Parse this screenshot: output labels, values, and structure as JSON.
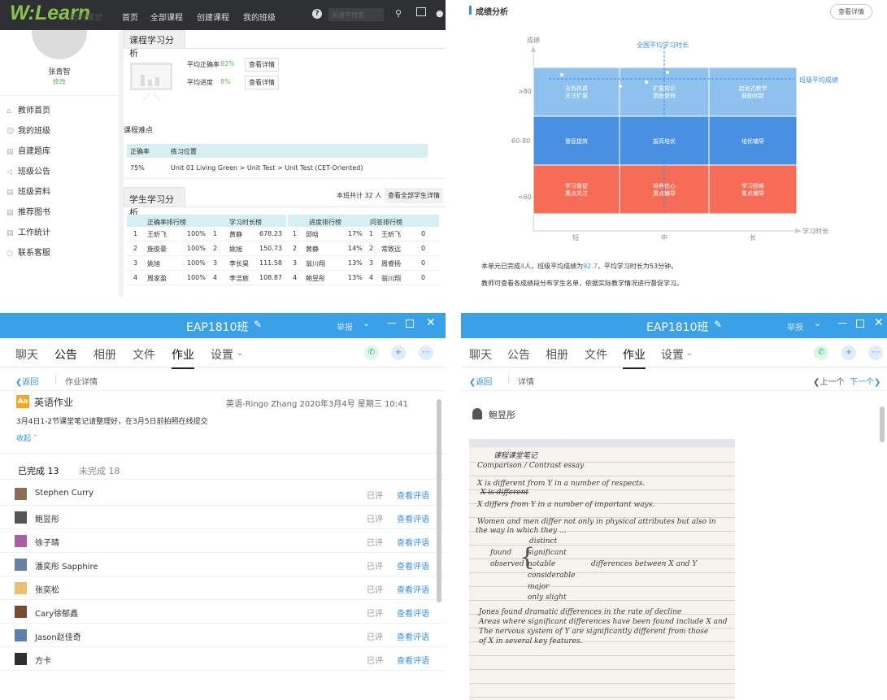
{
  "q1": {
    "logo": "W:Learn",
    "logo_sub": "随行课堂",
    "nav": [
      "首页",
      "全部课程",
      "创建课程",
      "我的班级"
    ],
    "search_placeholder": "关键字搜索",
    "user_name": "张青智",
    "user_edit": "修改",
    "side_items": [
      {
        "label": "教师首页",
        "icon": "home-icon"
      },
      {
        "label": "我的班级",
        "icon": "users-icon"
      },
      {
        "label": "自建题库",
        "icon": "book-icon"
      },
      {
        "label": "班级公告",
        "icon": "megaphone-icon"
      },
      {
        "label": "班级资料",
        "icon": "file-icon"
      },
      {
        "label": "推荐图书",
        "icon": "books-icon"
      },
      {
        "label": "工作统计",
        "icon": "stats-icon"
      },
      {
        "label": "联系客服",
        "icon": "support-icon"
      }
    ],
    "course_tab": "课程学习分析",
    "avg_correct_label": "平均正确率",
    "avg_correct_value": "82%",
    "avg_progress_label": "平均进度",
    "avg_progress_value": "8%",
    "view_detail": "查看详情",
    "difficulty_title": "课程难点",
    "difficulty_header": [
      "正确率",
      "练习位置"
    ],
    "difficulty_row": [
      "75%",
      "Unit 01 Living Green > Unit Test > Unit Test (CET-Oriented)"
    ],
    "student_tab": "学生学习分析",
    "class_count": "本班共计 32 人",
    "view_all": "查看全部学生详情",
    "rank_headers": [
      "正确率排行榜",
      "学习时长榜",
      "进度排行榜",
      "问答排行榜"
    ],
    "rank_rows": [
      [
        [
          "1",
          "王昕飞",
          "100%"
        ],
        [
          "1",
          "黄静",
          "678.23"
        ],
        [
          "1",
          "邱晗",
          "17%"
        ],
        [
          "1",
          "王昕飞",
          "0"
        ]
      ],
      [
        [
          "2",
          "施俊豪",
          "100%"
        ],
        [
          "2",
          "姚旭",
          "150.73"
        ],
        [
          "2",
          "黄静",
          "14%"
        ],
        [
          "2",
          "常致远",
          "0"
        ]
      ],
      [
        [
          "3",
          "姚旭",
          "100%"
        ],
        [
          "3",
          "李长昊",
          "111.58"
        ],
        [
          "3",
          "翁川翔",
          "13%"
        ],
        [
          "3",
          "周睿扬",
          "0"
        ]
      ],
      [
        [
          "4",
          "周家盈",
          "100%"
        ],
        [
          "4",
          "李浩宸",
          "108.87"
        ],
        [
          "4",
          "鲍昱彤",
          "13%"
        ],
        [
          "4",
          "翁川翔",
          "0"
        ]
      ]
    ]
  },
  "q2": {
    "title": "成绩分析",
    "detail_btn": "查看详情",
    "y_axis": "成绩",
    "x_axis": "学习时长",
    "avg_time_label": "全国平均学习时长",
    "avg_score_label": "班级平均成绩",
    "rows": [
      ">80",
      "60-80",
      "<60"
    ],
    "cols": [
      "短",
      "中",
      "长"
    ],
    "cells": [
      [
        "去伪存真\n关注扩展",
        "扩展知识\n激励提效",
        "启发式教学\n鼓励创新"
      ],
      [
        "督促提效",
        "拔高培优",
        "培优辅导"
      ],
      [
        "学习督促\n重点关注",
        "培养信心\n重点辅导",
        "学习困难\n重点辅导"
      ]
    ],
    "cell_colors": [
      "#8fc1ee",
      "#4a90e2",
      "#f76c57"
    ],
    "summary_prefix": "本单元已完成",
    "summary_count": "4",
    "summary_mid": "人，班级平均成绩为",
    "summary_score": "92.7",
    "summary_suffix": "，平均学习时长为53分钟。",
    "summary_line2": "教师可查看各成绩段分布学生名单，依据实际教学情况进行督促学习。"
  },
  "q3": {
    "window_title": "EAP1810班",
    "report": "举报",
    "tabs": [
      "聊天",
      "公告",
      "相册",
      "文件",
      "作业",
      "设置"
    ],
    "back": "返回",
    "crumb": "作业详情",
    "hw_badge": "Aa",
    "hw_title": "英语作业",
    "hw_meta": "英语-Ringo Zhang 2020年3月4号 星期三 10:41",
    "hw_desc": "3月4日1-2节课堂笔记请整理好，在3月5日前拍照在线提交",
    "collapse": "收起",
    "done_tab": "已完成 13",
    "undone_tab": "未完成 18",
    "students": [
      {
        "name": "Stephen Curry",
        "color": "#8a6e5a"
      },
      {
        "name": "鲍昱彤",
        "color": "#555555"
      },
      {
        "name": "徐子晴",
        "color": "#a85fa8"
      },
      {
        "name": "潘奕彤 Sapphire",
        "color": "#6b7fa0"
      },
      {
        "name": "张奕松",
        "color": "#e8c070"
      },
      {
        "name": "Cary徐郁鑫",
        "color": "#7a4a30"
      },
      {
        "name": "Jason赵佳奇",
        "color": "#5a7fb0"
      },
      {
        "name": "方卡",
        "color": "#2f2f2f"
      }
    ],
    "status": "已评",
    "review": "查看评语"
  },
  "q4": {
    "window_title": "EAP1810班",
    "report": "举报",
    "tabs": [
      "聊天",
      "公告",
      "相册",
      "文件",
      "作业",
      "设置"
    ],
    "back": "返回",
    "crumb": "详情",
    "prev": "上一个",
    "next": "下一个",
    "student": "鲍昱彤",
    "notes": [
      "课程课堂笔记",
      "Comparison / Contrast essay",
      "X is different from Y in a number of respects.",
      "X is different",
      "X differs from Y in a number of important ways.",
      "Women and men differ not only in physical attributes but also in",
      "the way in which they ...",
      "distinct",
      "found",
      "significant",
      "observed",
      "notable",
      "differences between X and Y",
      "considerable",
      "major",
      "only slight",
      "Jones found dramatic differences in the rate of decline",
      "Areas where significant differences have been found include X and",
      "The nervous system of Y are significantly different from those",
      "of X in several key features."
    ]
  }
}
